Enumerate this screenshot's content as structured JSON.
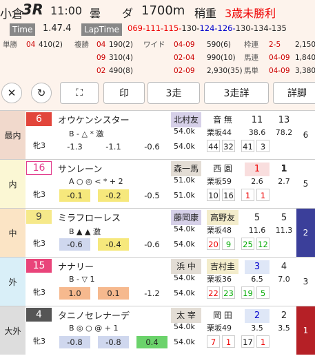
{
  "race": {
    "venue": "小倉",
    "number": "3R",
    "time": "11:00",
    "weather": "曇",
    "surface": "ダ",
    "distance": "1700m",
    "weight_cond": "稍重",
    "name": "3歳未勝利"
  },
  "result": {
    "time_label": "Time",
    "time": "1.47.4",
    "laptime_label": "LapTime",
    "laps": [
      {
        "t": "069-",
        "c": "#e00"
      },
      {
        "t": "111-",
        "c": "#e00"
      },
      {
        "t": "115-",
        "c": "#e00"
      },
      {
        "t": "130-",
        "c": "#222"
      },
      {
        "t": "124-",
        "c": "#00c"
      },
      {
        "t": "126-",
        "c": "#00c"
      },
      {
        "t": "130-",
        "c": "#222"
      },
      {
        "t": "134-",
        "c": "#222"
      },
      {
        "t": "135",
        "c": "#222"
      }
    ]
  },
  "payouts": {
    "l1": {
      "a": "単勝",
      "a1": "04",
      "a2": "410(2)",
      "b": "複勝",
      "b1": "04",
      "b2": "190(2)",
      "c": "ワイド",
      "c1": "04-09",
      "c2": "590(6)",
      "d": "枠連",
      "d1": "2-5",
      "d2": "2,150"
    },
    "l2": {
      "b1": "09",
      "b2": "310(4)",
      "c1": "02-04",
      "c2": "990(10)",
      "d": "馬連",
      "d1": "04-09",
      "d2": "1,840"
    },
    "l3": {
      "b1": "02",
      "b2": "490(8)",
      "c1": "02-09",
      "c2": "2,930(35)",
      "d": "馬単",
      "d1": "04-09",
      "d2": "3,380"
    }
  },
  "toolbar": {
    "close": "✕",
    "reload": "↻",
    "expand": "⛶",
    "mark": "印",
    "r3": "3走",
    "r3d": "3走詳",
    "detail": "詳脚"
  },
  "horses": [
    {
      "pos": "最内",
      "pos_color": "#f1d9cc",
      "num": "6",
      "num_bg": "#e2453b",
      "num_color": "#fff",
      "num_border": "#e2453b",
      "sex": "牝3",
      "name": "オウケンシスター",
      "marks": "B - △   * 激",
      "ix": [
        {
          "v": "-1.3",
          "bg": "#fff"
        },
        {
          "v": "-1.1",
          "bg": "#fff"
        },
        {
          "v": "-0.6",
          "bg": "#fff"
        }
      ],
      "jockey": "北村友",
      "jk_bg": "#d6d0e8",
      "trainer": "音 無",
      "tr_hl": false,
      "w1": "54.0k",
      "w2": "54.0k",
      "hs": "栗坂44",
      "b1": "44",
      "b2": "32",
      "b1c": "#222",
      "b2c": "#222",
      "pop": "11",
      "pop_bg": "transparent",
      "pop_c": "#222",
      "odds": "38.6",
      "s1": "41",
      "s2": "3",
      "s1c": "#222",
      "s2c": "#222",
      "fin": "13",
      "finodds": "78.2",
      "fin2": "6",
      "fin_bg": "#fff",
      "fin_c": "#222"
    },
    {
      "pos": "内",
      "pos_color": "#fbf7d4",
      "num": "16",
      "num_bg": "#fff",
      "num_color": "#e23b8c",
      "num_border": "#e23b8c",
      "sex": "牝3",
      "name": "サンレーン",
      "marks": "A ○ ◎ < *  + 2",
      "ix": [
        {
          "v": "-0.1",
          "bg": "#f6e87c"
        },
        {
          "v": "-0.2",
          "bg": "#f6e87c"
        },
        {
          "v": "-0.5",
          "bg": "#fff"
        }
      ],
      "jockey": "森一馬",
      "jk_bg": "#e3ddd5",
      "trainer": "西 園",
      "tr_hl": false,
      "w1": "51.0k",
      "w2": "51.0k",
      "hs": "栗坂59",
      "b1": "10",
      "b2": "16",
      "b1c": "#222",
      "b2c": "#222",
      "pop": "1",
      "pop_bg": "#f9dede",
      "pop_c": "#e00",
      "odds": "2.6",
      "s1": "1",
      "s2": "1",
      "s1c": "#e00",
      "s2c": "#e00",
      "fin": "1",
      "finodds": "2.7",
      "fin2": "5",
      "fin_bg": "#fff",
      "fin_c": "#222",
      "fin_bold": true
    },
    {
      "pos": "中",
      "pos_color": "#fbe4c5",
      "num": "9",
      "num_bg": "#f6e98a",
      "num_color": "#444",
      "num_border": "#f6e98a",
      "sex": "牝3",
      "name": "ミラフローレス",
      "marks": "B ▲ ▲    激",
      "ix": [
        {
          "v": "-0.6",
          "bg": "#cfd7ee"
        },
        {
          "v": "-0.4",
          "bg": "#f6e87c"
        },
        {
          "v": "-0.6",
          "bg": "#fff"
        }
      ],
      "jockey": "藤岡康",
      "jk_bg": "#d6d0e8",
      "trainer": "高野友",
      "tr_hl": true,
      "w1": "54.0k",
      "w2": "54.0k",
      "hs": "栗坂48",
      "b1": "20",
      "b2": "9",
      "b1c": "#e00",
      "b2c": "#0a0",
      "pop": "5",
      "pop_bg": "transparent",
      "pop_c": "#222",
      "odds": "11.6",
      "s1": "25",
      "s2": "12",
      "s1c": "#0a0",
      "s2c": "#0a0",
      "fin": "5",
      "finodds": "11.3",
      "fin2": "2",
      "fin_bg": "#3b3f9a",
      "fin_c": "#fff"
    },
    {
      "pos": "外",
      "pos_color": "#d9eff8",
      "num": "15",
      "num_bg": "#e9447a",
      "num_color": "#fff",
      "num_border": "#e9447a",
      "sex": "牝3",
      "name": "ナナリー",
      "marks": "B - ▽      1",
      "ix": [
        {
          "v": "1.0",
          "bg": "#f6b98e"
        },
        {
          "v": "0.1",
          "bg": "#f6b98e"
        },
        {
          "v": "-1.2",
          "bg": "#fff"
        }
      ],
      "jockey": "浜 中",
      "jk_bg": "#e3ddd5",
      "trainer": "吉村圭",
      "tr_hl": true,
      "w1": "54.0k",
      "w2": "54.0k",
      "hs": "栗坂36",
      "b1": "22",
      "b2": "23",
      "b1c": "#e00",
      "b2c": "#0a0",
      "pop": "3",
      "pop_bg": "#dfe7f7",
      "pop_c": "#00c",
      "odds": "6.5",
      "s1": "19",
      "s2": "5",
      "s1c": "#0a0",
      "s2c": "#0a0",
      "fin": "4",
      "finodds": "7.0",
      "fin2": "3",
      "fin_bg": "#fff",
      "fin_c": "#222"
    },
    {
      "pos": "大外",
      "pos_color": "#dddddd",
      "num": "4",
      "num_bg": "#555",
      "num_color": "#fff",
      "num_border": "#555",
      "sex": "牝3",
      "name": "タニノセレナーデ",
      "marks": "B ◎ ○  @  + 1",
      "ix": [
        {
          "v": "-0.8",
          "bg": "#cfd7ee"
        },
        {
          "v": "-0.8",
          "bg": "#cfd7ee"
        },
        {
          "v": "0.4",
          "bg": "#6bd36b"
        }
      ],
      "jockey": "太 宰",
      "jk_bg": "#e3ddd5",
      "trainer": "岡 田",
      "tr_hl": false,
      "w1": "54.0k",
      "w2": "54.0k",
      "hs": "栗坂49",
      "b1": "7",
      "b2": "1",
      "b1c": "#e00",
      "b2c": "#e00",
      "pop": "2",
      "pop_bg": "#dfe7f7",
      "pop_c": "#00c",
      "odds": "3.5",
      "s1": "17",
      "s2": "1",
      "s1c": "#222",
      "s2c": "#e00",
      "fin": "2",
      "finodds": "3.5",
      "fin2": "1",
      "fin_bg": "#b52026",
      "fin_c": "#fff"
    }
  ]
}
